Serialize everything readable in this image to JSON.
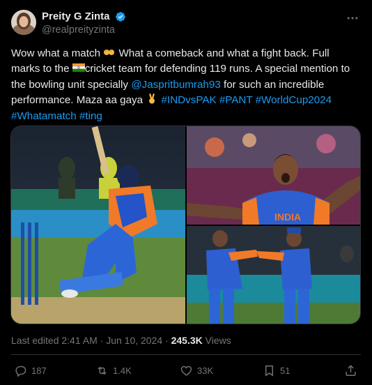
{
  "author": {
    "display_name": "Preity G Zinta",
    "handle": "@realpreityzinta",
    "verified": true
  },
  "post": {
    "line1_a": "Wow what a match ",
    "line1_b": " What a comeback and what a fight back. Full",
    "line2_a": "marks to the ",
    "line2_b": "cricket team for defending 119 runs. A special mention to",
    "line3_a": "the bowling unit specially ",
    "mention": "@Jaspritbumrah93",
    "line3_b": " for such an incredible",
    "line4_a": "performance. Maza aa gaya ",
    "hashtags_line4": " #INDvsPAK #PANT #WorldCup2024",
    "hashtags_line5": "#Whatamatch #ting",
    "emoji_clap": "clapping-hands",
    "emoji_flag": "india-flag",
    "emoji_victory": "victory-hand"
  },
  "media": {
    "photo_label": "INDIA"
  },
  "meta": {
    "edited": "Last edited 2:41 AM · Jun 10, 2024 · ",
    "views_count": "245.3K",
    "views_label": " Views"
  },
  "actions": {
    "replies": "187",
    "reposts": "1.4K",
    "likes": "33K",
    "bookmarks": "51"
  },
  "colors": {
    "background": "#000000",
    "text": "#e7e9ea",
    "muted": "#71767b",
    "link": "#1d9bf0",
    "divider": "#2f3336"
  }
}
